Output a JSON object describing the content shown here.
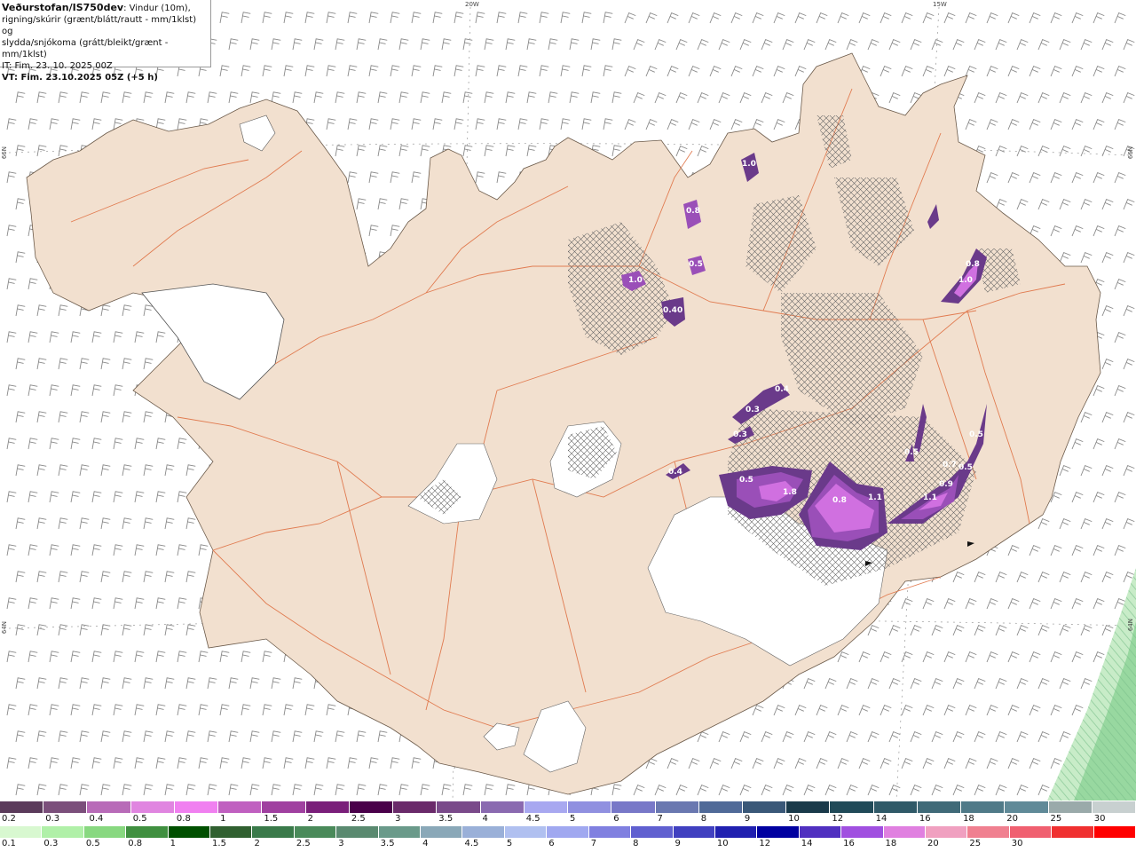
{
  "header": {
    "title_bold": "Veðurstofan/IS750dev",
    "title_rest": ": Vindur (10m),",
    "line2": "rigning/skúrir (grænt/blátt/rautt - mm/1klst) og",
    "line3": "slydda/snjókoma (grátt/bleikt/grænt - mm/1klst)",
    "it": "IT: Fim. 23. 10. 2025 00Z",
    "vt": "VT: Fim. 23.10.2025 05Z (+5 h)"
  },
  "map": {
    "land_color": "#f2e0cf",
    "road_color": "#e0764a",
    "glacier_color": "#ffffff",
    "precip_colors": [
      "#6a3a8a",
      "#9a4fb8",
      "#d070e0",
      "#f090f8"
    ],
    "coord_labels": {
      "top_20w": "20W",
      "top_15w": "15W",
      "left_66n": "66N",
      "right_66n": "66N",
      "left_64n": "64N",
      "right_64n": "64N"
    },
    "precip_values": [
      "1.0",
      "0.8",
      "0.5",
      "1.0",
      "0.40",
      "0.8",
      "1.0",
      "0.4",
      "0.3",
      "0.3",
      "0.4",
      "0.5",
      "1.8",
      "0.8",
      "1.1",
      "1.1",
      "0.9",
      "0.7",
      "0.5",
      "0.5",
      "0.5"
    ]
  },
  "legend_top": {
    "colors": [
      "#5b3b5b",
      "#7b4f7b",
      "#b86bb8",
      "#e085e0",
      "#f080f0",
      "#c060c0",
      "#a040a0",
      "#7a1f7a",
      "#4a004a",
      "#6a2a6a",
      "#7a4a8a",
      "#8a6ab0",
      "#a8a8f0",
      "#9090e0",
      "#7878c8",
      "#6a78b0",
      "#506a98",
      "#3a5878",
      "#1a3a4a",
      "#204a58",
      "#305a68",
      "#406a78",
      "#507a88",
      "#608a98",
      "#9aaaaa",
      "#c8d0d0"
    ],
    "labels": [
      "0.2",
      "0.3",
      "0.4",
      "0.5",
      "0.8",
      "1",
      "1.5",
      "2",
      "2.5",
      "3",
      "3.5",
      "4",
      "4.5",
      "5",
      "6",
      "7",
      "8",
      "9",
      "10",
      "12",
      "14",
      "16",
      "18",
      "20",
      "25",
      "30"
    ]
  },
  "legend_bottom": {
    "colors": [
      "#d8f8d0",
      "#b0f0a8",
      "#88d880",
      "#409040",
      "#005000",
      "#306030",
      "#3a7a4a",
      "#4a8a5a",
      "#5a8a70",
      "#6a9a8a",
      "#8aa8b8",
      "#9ab0d8",
      "#b0c0f0",
      "#a0a8f0",
      "#8080e0",
      "#6060d0",
      "#4040c0",
      "#2020b0",
      "#0000a0",
      "#5030c0",
      "#a050e0",
      "#e080e0",
      "#f0a0c0",
      "#f08090",
      "#f06070",
      "#f03030",
      "#ff0000"
    ],
    "labels": [
      "0.1",
      "0.3",
      "0.5",
      "0.8",
      "1",
      "1.5",
      "2",
      "2.5",
      "3",
      "3.5",
      "4",
      "4.5",
      "5",
      "6",
      "7",
      "8",
      "9",
      "10",
      "12",
      "14",
      "16",
      "18",
      "20",
      "25",
      "30"
    ]
  }
}
